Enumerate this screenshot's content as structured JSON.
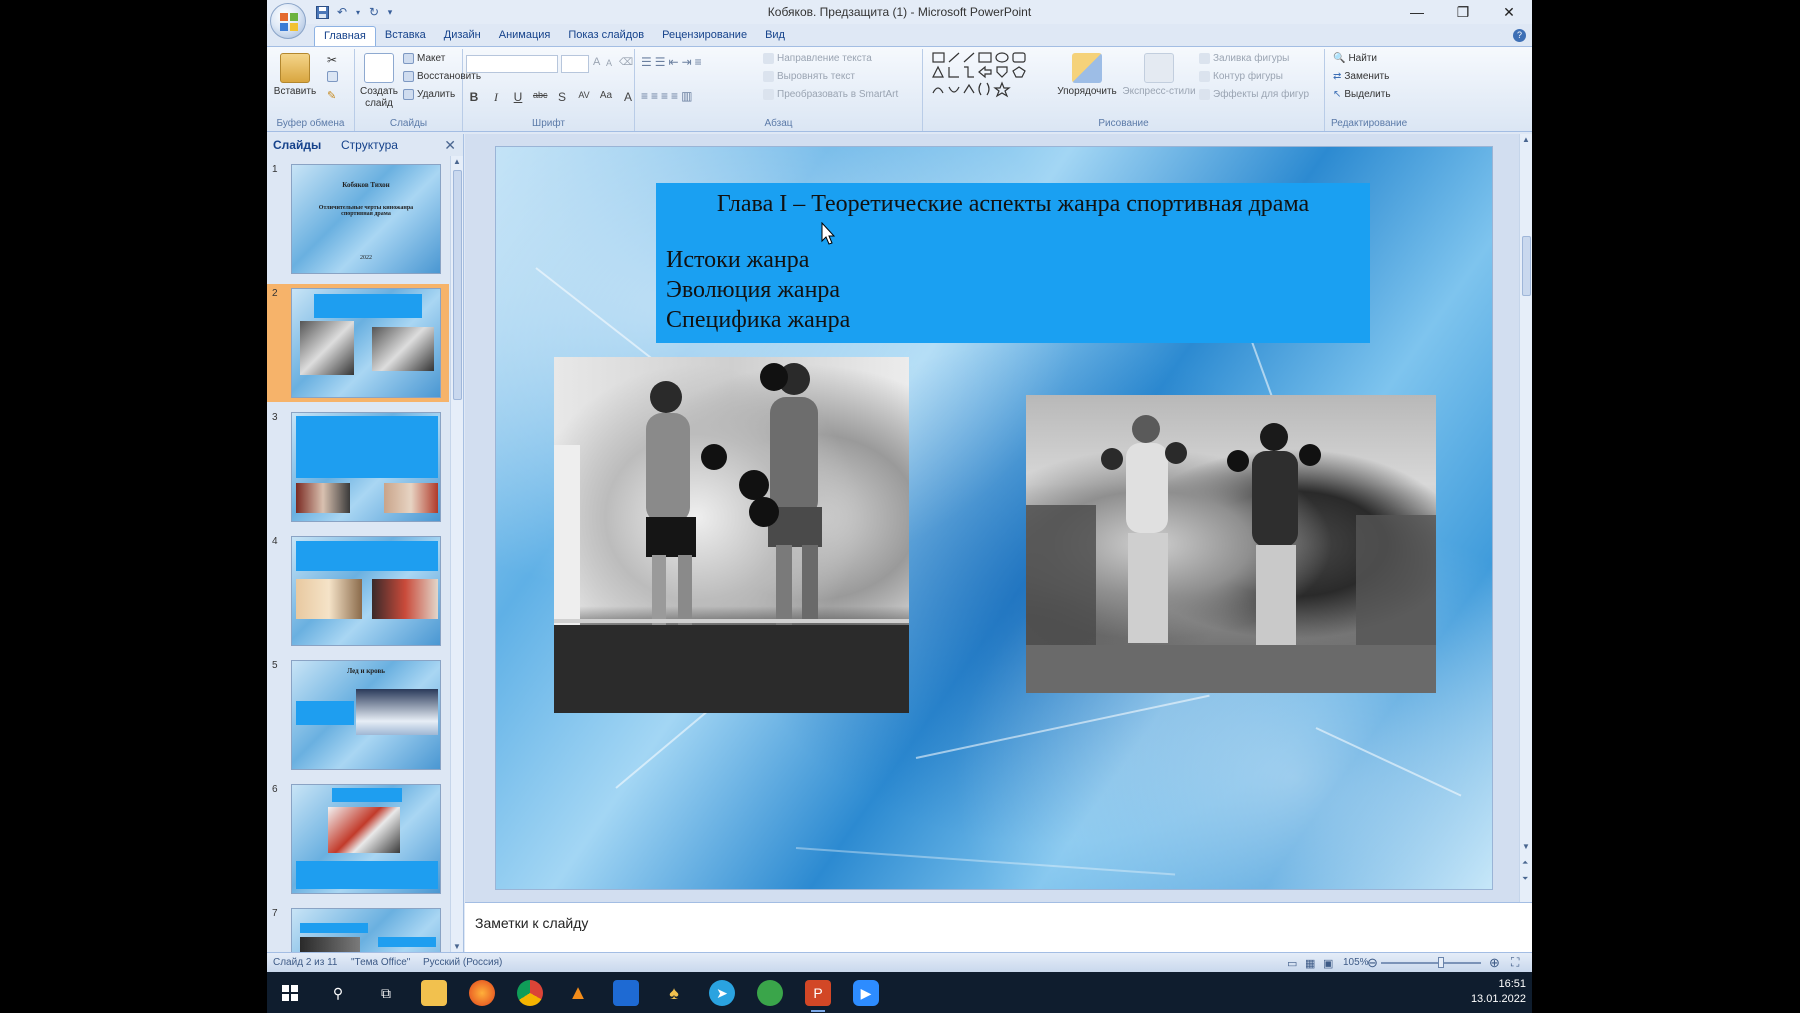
{
  "window": {
    "title": "Кобяков. Предзащита (1) - Microsoft PowerPoint",
    "minimize": "—",
    "restore": "❐",
    "close": "✕"
  },
  "ribbon_tabs": [
    "Главная",
    "Вставка",
    "Дизайн",
    "Анимация",
    "Показ слайдов",
    "Рецензирование",
    "Вид"
  ],
  "ribbon": {
    "clipboard": {
      "label": "Буфер обмена",
      "paste": "Вставить"
    },
    "slides": {
      "label": "Слайды",
      "new_slide_1": "Создать",
      "new_slide_2": "слайд",
      "layout": "Макет",
      "reset": "Восстановить",
      "delete": "Удалить"
    },
    "font": {
      "label": "Шрифт",
      "bold": "B",
      "italic": "I",
      "underline": "U",
      "strike": "abc",
      "shadow": "S",
      "spacing": "AV",
      "case": "Aa",
      "color": "A"
    },
    "paragraph": {
      "label": "Абзац",
      "text_direction": "Направление текста",
      "align_text": "Выровнять текст",
      "smartart": "Преобразовать в SmartArt"
    },
    "drawing": {
      "label": "Рисование",
      "arrange": "Упорядочить",
      "quick_styles": "Экспресс-стили",
      "fill": "Заливка фигуры",
      "outline": "Контур фигуры",
      "effects": "Эффекты для фигур"
    },
    "editing": {
      "label": "Редактирование",
      "find": "Найти",
      "replace": "Заменить",
      "select": "Выделить"
    }
  },
  "left_panel": {
    "tab_slides": "Слайды",
    "tab_outline": "Структура",
    "close": "✕",
    "thumbnails": [
      {
        "num": "1",
        "title": "Кобяков Тихон",
        "subtitle": "Отличительные черты киножанра спортивная драма",
        "footer": "2022"
      },
      {
        "num": "2"
      },
      {
        "num": "3"
      },
      {
        "num": "4"
      },
      {
        "num": "5",
        "title": "Лед и кровь"
      },
      {
        "num": "6"
      },
      {
        "num": "7"
      }
    ]
  },
  "slide": {
    "title": "Глава I – Теоретические аспекты жанра спортивная драма",
    "bullets": [
      "Истоки жанра",
      "Эволюция жанра",
      "Специфика жанра"
    ]
  },
  "notes": {
    "placeholder": "Заметки к слайду"
  },
  "status": {
    "slide_info": "Слайд 2 из 11",
    "theme": "\"Тема Office\"",
    "language": "Русский (Россия)",
    "zoom": "105%"
  },
  "taskbar": {
    "time": "16:51",
    "date": "13.01.2022"
  },
  "colors": {
    "title_box": "#1aa0f2",
    "selected_thumb": "#f6b36a",
    "ribbon_text": "#15428b"
  }
}
